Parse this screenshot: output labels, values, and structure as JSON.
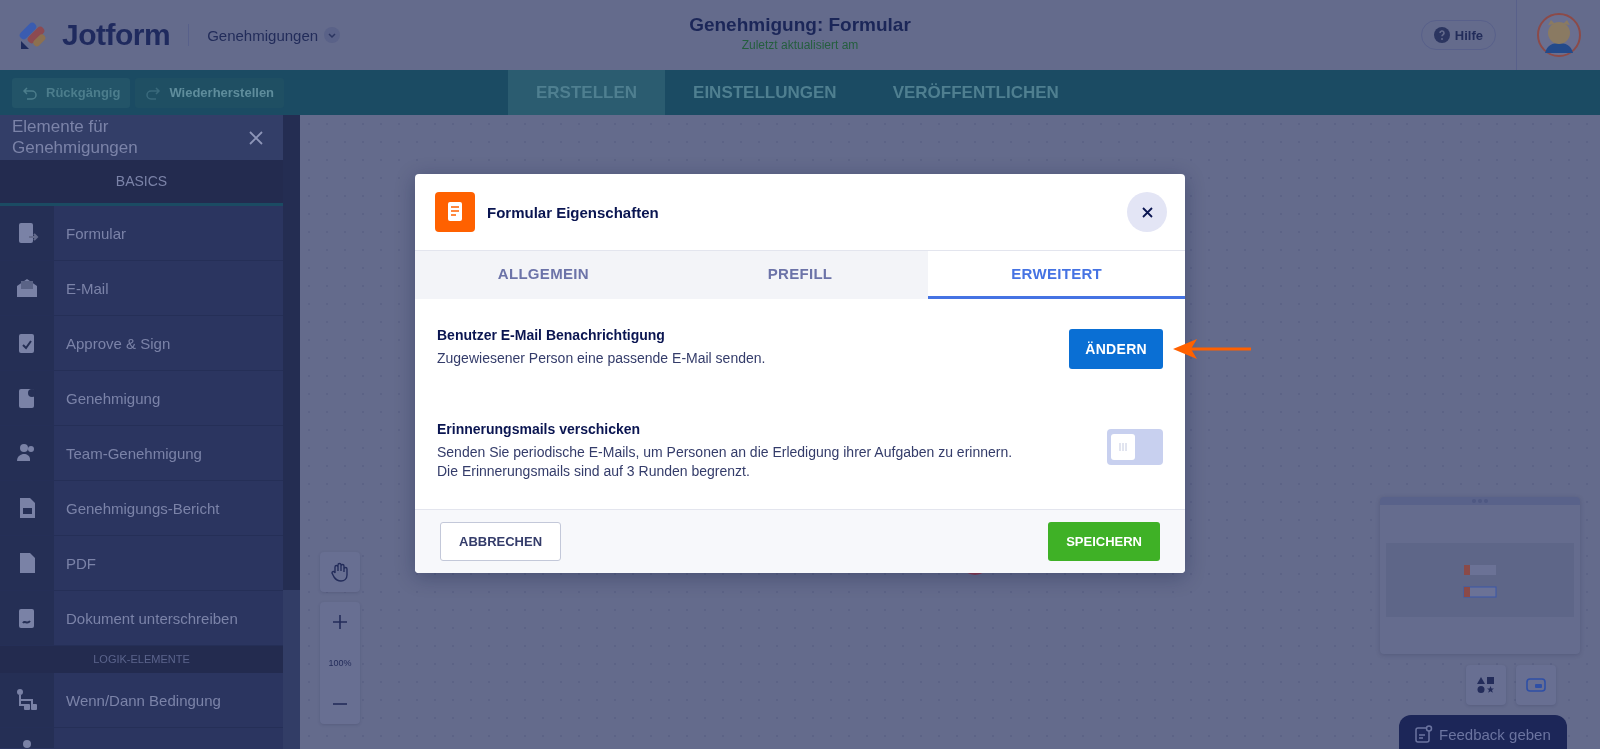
{
  "header": {
    "brand": "Jotform",
    "workspace": "Genehmigungen",
    "title": "Genehmigung: Formular",
    "subtitle": "Zuletzt aktualisiert am",
    "help": "Hilfe"
  },
  "toolbar": {
    "undo": "Rückgängig",
    "redo": "Wiederherstellen",
    "tabs": [
      {
        "label": "ERSTELLEN",
        "selected": true
      },
      {
        "label": "EINSTELLUNGEN",
        "selected": false
      },
      {
        "label": "VERÖFFENTLICHEN",
        "selected": false
      }
    ]
  },
  "sidebar": {
    "title": "Elemente für Genehmigungen",
    "section": "BASICS",
    "items": [
      {
        "label": "Formular"
      },
      {
        "label": "E-Mail"
      },
      {
        "label": "Approve & Sign"
      },
      {
        "label": "Genehmigung"
      },
      {
        "label": "Team-Genehmigung"
      },
      {
        "label": "Genehmigungs-Bericht"
      },
      {
        "label": "PDF"
      },
      {
        "label": "Dokument unterschreiben"
      }
    ],
    "logic_section": "LOGIK-ELEMENTE",
    "logic_items": [
      {
        "label": "Wenn/Dann Bedingung"
      }
    ]
  },
  "canvas": {
    "zoom": "100%",
    "feedback": "Feedback geben"
  },
  "dialog": {
    "title": "Formular Eigenschaften",
    "tabs": [
      {
        "label": "ALLGEMEIN",
        "selected": false
      },
      {
        "label": "PREFILL",
        "selected": false
      },
      {
        "label": "ERWEITERT",
        "selected": true
      }
    ],
    "settings": [
      {
        "kind": "button",
        "title": "Benutzer E-Mail Benachrichtigung",
        "description": "Zugewiesener Person eine passende E-Mail senden.",
        "button": "ÄNDERN"
      },
      {
        "kind": "toggle",
        "title": "Erinnerungsmails verschicken",
        "description": "Senden Sie periodische E-Mails, um Personen an die Erledigung ihrer Aufgaben zu erinnern. Die Erinnerungsmails sind auf 3 Runden begrenzt.",
        "on": false
      }
    ],
    "cancel": "ABBRECHEN",
    "save": "SPEICHERN"
  }
}
